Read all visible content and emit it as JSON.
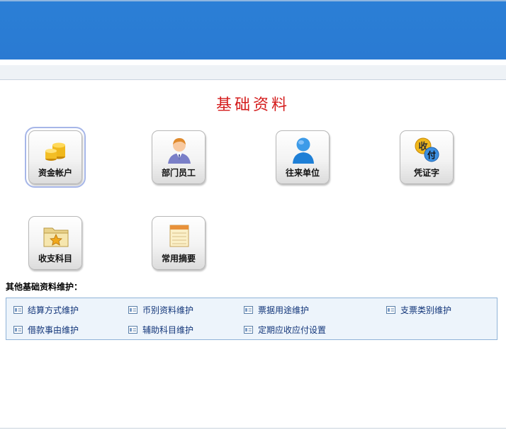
{
  "page": {
    "title": "基础资料"
  },
  "tiles": [
    {
      "label": "资金帐户",
      "icon": "coins-icon"
    },
    {
      "label": "部门员工",
      "icon": "employee-icon"
    },
    {
      "label": "往来单位",
      "icon": "contact-person-icon"
    },
    {
      "label": "凭证字",
      "icon": "voucher-icon",
      "icon_text_1": "收",
      "icon_text_2": "付"
    },
    {
      "label": "收支科目",
      "icon": "folder-star-icon"
    },
    {
      "label": "常用摘要",
      "icon": "notepad-icon"
    }
  ],
  "other": {
    "heading": "其他基础资料维护：",
    "links": [
      "结算方式维护",
      "币别资料维护",
      "票据用途维护",
      "支票类别维护",
      "借款事由维护",
      "辅助科目维护",
      "定期应收应付设置"
    ]
  },
  "colors": {
    "header_blue": "#2b7fd6",
    "title_red": "#d41c1c",
    "link_blue": "#13367a"
  }
}
